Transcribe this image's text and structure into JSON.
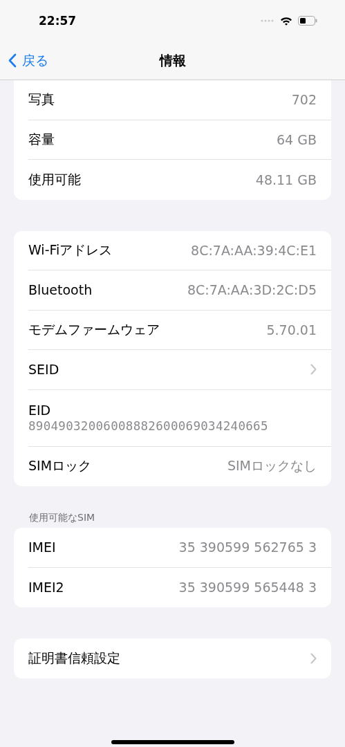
{
  "status_bar": {
    "time": "22:57"
  },
  "nav": {
    "back": "戻る",
    "title": "情報"
  },
  "groups": [
    {
      "rows": [
        {
          "kind": "value",
          "label": "写真",
          "value": "702"
        },
        {
          "kind": "value",
          "label": "容量",
          "value": "64 GB"
        },
        {
          "kind": "value",
          "label": "使用可能",
          "value": "48.11 GB"
        }
      ]
    },
    {
      "rows": [
        {
          "kind": "value",
          "label": "Wi-Fiアドレス",
          "value": "8C:7A:AA:39:4C:E1"
        },
        {
          "kind": "value",
          "label": "Bluetooth",
          "value": "8C:7A:AA:3D:2C:D5"
        },
        {
          "kind": "value",
          "label": "モデムファームウェア",
          "value": "5.70.01"
        },
        {
          "kind": "chevron",
          "label": "SEID"
        },
        {
          "kind": "stacked",
          "label": "EID",
          "value": "89049032006008882600069034240665"
        },
        {
          "kind": "value",
          "label": "SIMロック",
          "value": "SIMロックなし"
        }
      ]
    },
    {
      "header": "使用可能なSIM",
      "rows": [
        {
          "kind": "value",
          "label": "IMEI",
          "value": "35 390599 562765 3"
        },
        {
          "kind": "value",
          "label": "IMEI2",
          "value": "35 390599 565448 3"
        }
      ]
    },
    {
      "rows": [
        {
          "kind": "chevron",
          "label": "証明書信頼設定"
        }
      ]
    }
  ]
}
